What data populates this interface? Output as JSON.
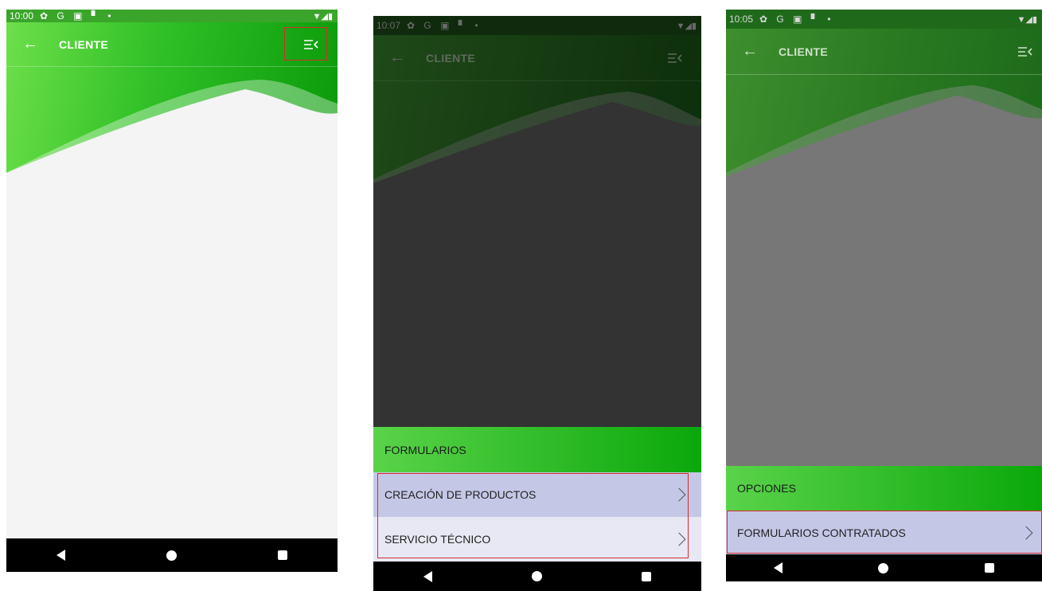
{
  "screens": [
    {
      "time": "10:00",
      "status_icons": "✿ G ▣ ▘ •",
      "title": "CLIENTE"
    },
    {
      "time": "10:07",
      "status_icons": "✿ G ▣ ▘ •",
      "title": "CLIENTE",
      "sheet_header": "FORMULARIOS",
      "items": [
        "CREACIÓN DE PRODUCTOS",
        "SERVICIO TÉCNICO"
      ]
    },
    {
      "time": "10:05",
      "status_icons": "✿ G ▣ ▘ •",
      "title": "CLIENTE",
      "sheet_header": "OPCIONES",
      "items": [
        "FORMULARIOS CONTRATADOS"
      ]
    }
  ],
  "colors": {
    "brand_green": "#33c633",
    "dark_green": "#0a9a0a",
    "highlight": "#d62b2b"
  },
  "icons": {
    "back": "arrow-left-icon",
    "menu": "menu-collapse-icon",
    "chevron": "chevron-right-icon",
    "nav_back": "triangle-back-icon",
    "nav_home": "circle-home-icon",
    "nav_recent": "square-recent-icon"
  }
}
